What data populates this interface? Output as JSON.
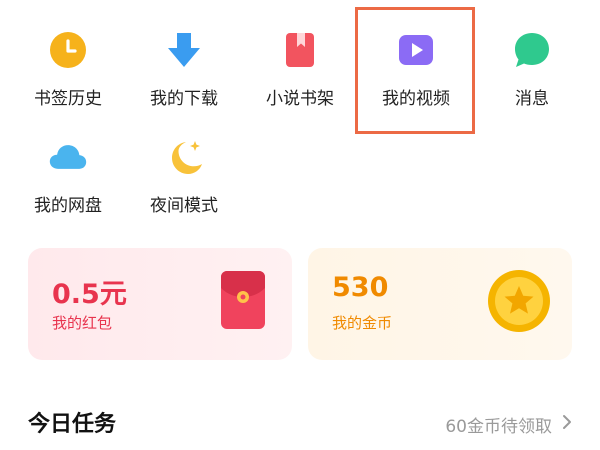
{
  "grid": {
    "items": [
      {
        "label": "书签历史",
        "icon": "clock-icon",
        "color": "#f6b21b"
      },
      {
        "label": "我的下载",
        "icon": "download-arrow-icon",
        "color": "#3a9cf0"
      },
      {
        "label": "小说书架",
        "icon": "bookmark-book-icon",
        "color": "#f2545f"
      },
      {
        "label": "我的视频",
        "icon": "video-play-icon",
        "color": "#8b6bf5"
      },
      {
        "label": "消息",
        "icon": "chat-bubble-icon",
        "color": "#2fc98e"
      },
      {
        "label": "我的网盘",
        "icon": "cloud-icon",
        "color": "#4ab4ee"
      },
      {
        "label": "夜间模式",
        "icon": "moon-star-icon",
        "color": "#f8c23a"
      }
    ]
  },
  "cards": {
    "red_packet": {
      "amount": "0.5元",
      "label": "我的红包",
      "icon": "red-envelope-icon"
    },
    "coins": {
      "amount": "530",
      "label": "我的金币",
      "icon": "gold-coin-star-icon"
    }
  },
  "tasks": {
    "title": "今日任务",
    "link": "60金币待领取"
  },
  "colors": {
    "highlight": "#ec6a45"
  }
}
